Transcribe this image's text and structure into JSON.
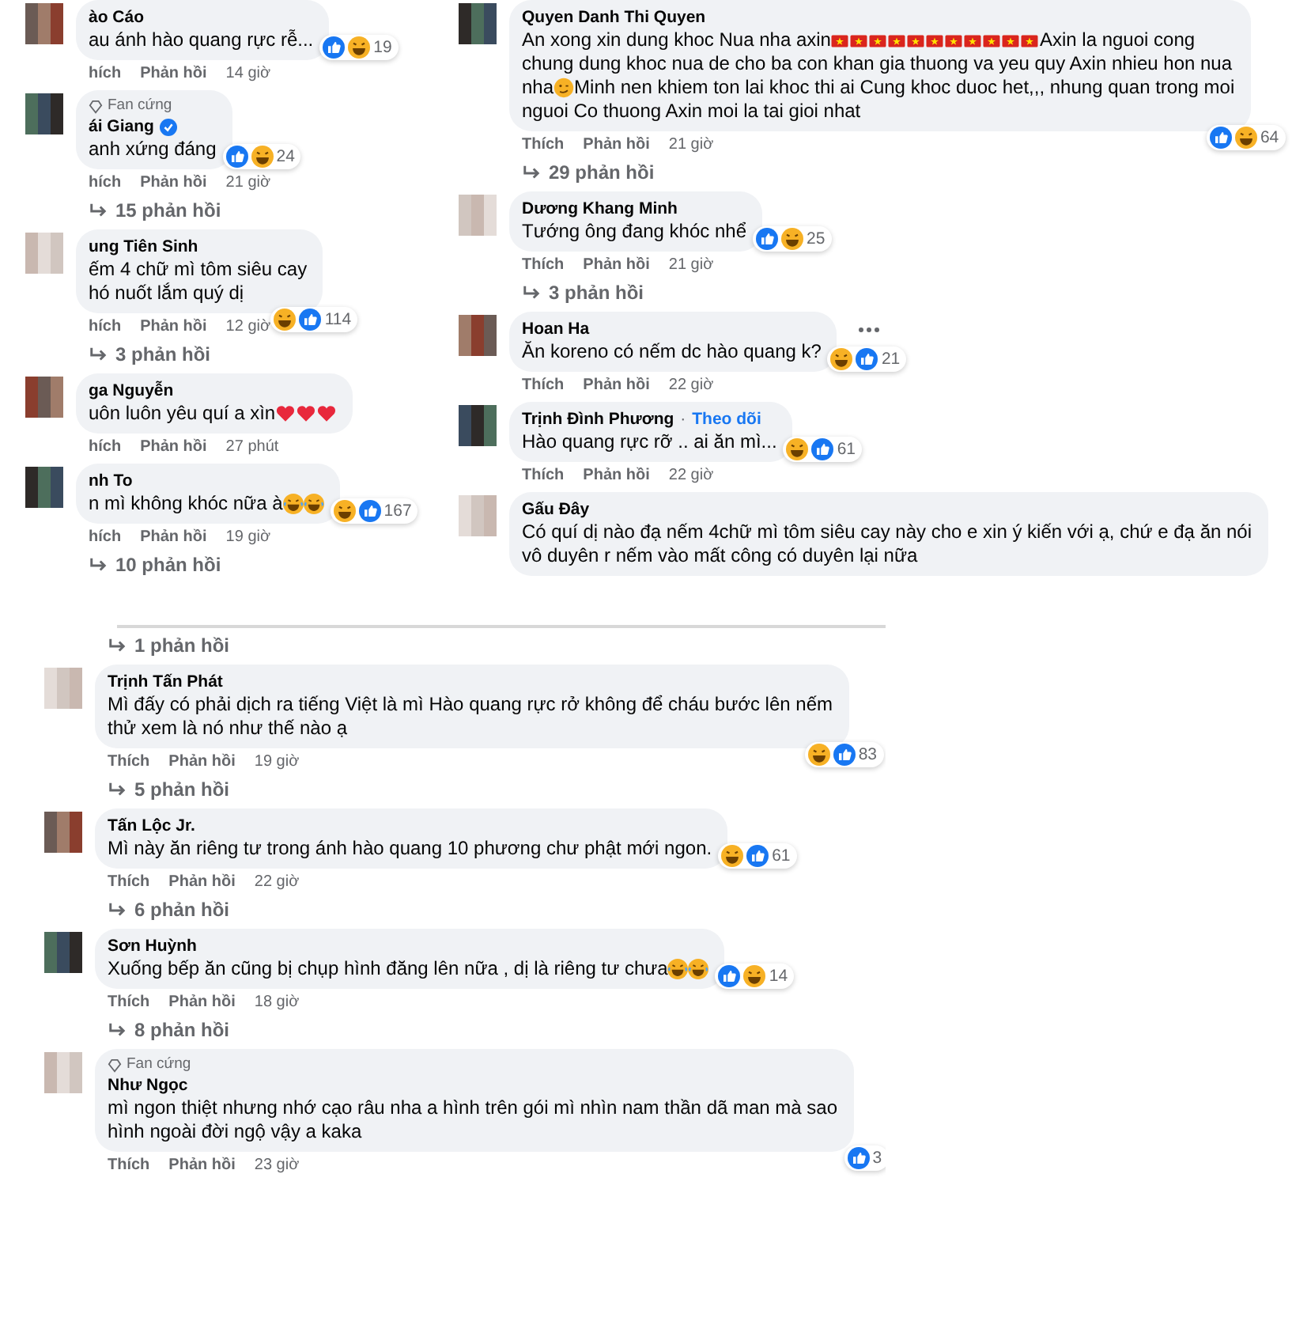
{
  "panels": [
    {
      "comments": [
        {
          "name": "ào Cáo",
          "verified": false,
          "menu": false,
          "lines": [
            [
              {
                "kind": "text",
                "text": "au ánh hào quang rực rễ..."
              }
            ]
          ],
          "reactions": [
            {
              "kind": "like"
            },
            {
              "kind": "haha"
            }
          ],
          "reaction_count": "19",
          "like": "hích",
          "reply": "Phản hồi",
          "time": "14 giờ"
        },
        {
          "badge": "Fan cứng",
          "name": "ái Giang",
          "verified": true,
          "menu": false,
          "lines": [
            [
              {
                "kind": "text",
                "text": "anh xứng đáng"
              }
            ]
          ],
          "reactions": [
            {
              "kind": "like"
            },
            {
              "kind": "haha"
            }
          ],
          "reaction_count": "24",
          "like": "hích",
          "reply": "Phản hồi",
          "time": "21 giờ",
          "replies": "15 phản hồi"
        },
        {
          "name": "ung Tiên Sinh",
          "verified": false,
          "menu": false,
          "lines": [
            [
              {
                "kind": "text",
                "text": "ếm 4 chữ mì tôm siêu cay"
              }
            ],
            [
              {
                "kind": "text",
                "text": "hó nuốt lắm quý dị"
              }
            ]
          ],
          "reactions": [
            {
              "kind": "haha"
            },
            {
              "kind": "like"
            }
          ],
          "reaction_count": "114",
          "like": "hích",
          "reply": "Phản hồi",
          "time": "12 giờ",
          "replies": "3 phản hồi"
        },
        {
          "name": "ga Nguyễn",
          "verified": false,
          "menu": false,
          "lines": [
            [
              {
                "kind": "text",
                "text": "uôn luôn yêu quí a xìn"
              },
              {
                "kind": "heart"
              },
              {
                "kind": "heart"
              },
              {
                "kind": "heart"
              }
            ]
          ],
          "like": "hích",
          "reply": "Phản hồi",
          "time": "27 phút"
        },
        {
          "name": "nh To",
          "verified": false,
          "menu": false,
          "lines": [
            [
              {
                "kind": "text",
                "text": "n mì không khóc nữa à"
              },
              {
                "kind": "laugh-cry"
              },
              {
                "kind": "laugh-cry"
              }
            ]
          ],
          "reactions": [
            {
              "kind": "haha"
            },
            {
              "kind": "like"
            }
          ],
          "reaction_count": "167",
          "like": "hích",
          "reply": "Phản hồi",
          "time": "19 giờ",
          "replies": "10 phản hồi"
        }
      ]
    },
    {
      "comments": [
        {
          "name": "Quyen Danh Thi Quyen",
          "verified": false,
          "menu": false,
          "lines": [
            [
              {
                "kind": "text",
                "text": "An xong xin dung khoc Nua nha axin"
              },
              {
                "kind": "flag"
              },
              {
                "kind": "flag"
              },
              {
                "kind": "flag"
              },
              {
                "kind": "flag"
              },
              {
                "kind": "flag"
              },
              {
                "kind": "flag"
              },
              {
                "kind": "flag"
              },
              {
                "kind": "flag"
              },
              {
                "kind": "flag"
              },
              {
                "kind": "flag"
              },
              {
                "kind": "flag"
              },
              {
                "kind": "text",
                "text": " Axin la nguoi cong"
              }
            ],
            [
              {
                "kind": "text",
                "text": "chung dung khoc nua de cho ba con khan gia thuong va yeu quy Axin nhieu hon nua"
              }
            ],
            [
              {
                "kind": "text",
                "text": "nha"
              },
              {
                "kind": "smirk"
              },
              {
                "kind": "text",
                "text": " Minh nen khiem ton lai khoc thi ai Cung khoc duoc het,,, nhung quan trong moi"
              }
            ],
            [
              {
                "kind": "text",
                "text": "nguoi Co thuong Axin moi la tai gioi nhat"
              }
            ]
          ],
          "reactions": [
            {
              "kind": "like"
            },
            {
              "kind": "haha"
            }
          ],
          "reaction_count": "64",
          "like": "Thích",
          "reply": "Phản hồi",
          "time": "21 giờ",
          "replies": "29 phản hồi"
        },
        {
          "name": "Dương Khang Minh",
          "verified": false,
          "menu": false,
          "lines": [
            [
              {
                "kind": "text",
                "text": "Tướng ông đang khóc nhể"
              }
            ]
          ],
          "reactions": [
            {
              "kind": "like"
            },
            {
              "kind": "haha"
            }
          ],
          "reaction_count": "25",
          "like": "Thích",
          "reply": "Phản hồi",
          "time": "21 giờ",
          "replies": "3 phản hồi"
        },
        {
          "name": "Hoan Ha",
          "verified": false,
          "menu": true,
          "lines": [
            [
              {
                "kind": "text",
                "text": "Ăn koreno có nếm dc hào quang k?"
              }
            ]
          ],
          "reactions": [
            {
              "kind": "haha"
            },
            {
              "kind": "like"
            }
          ],
          "reaction_count": "21",
          "like": "Thích",
          "reply": "Phản hồi",
          "time": "22 giờ"
        },
        {
          "name": "Trịnh Đình Phương",
          "separator": "·",
          "follow": "Theo dõi",
          "verified": false,
          "menu": false,
          "lines": [
            [
              {
                "kind": "text",
                "text": "Hào quang rực rỡ .. ai ăn mì..."
              }
            ]
          ],
          "reactions": [
            {
              "kind": "haha"
            },
            {
              "kind": "like"
            }
          ],
          "reaction_count": "61",
          "like": "Thích",
          "reply": "Phản hồi",
          "time": "22 giờ"
        },
        {
          "name": "Gấu Đây",
          "verified": false,
          "menu": false,
          "lines": [
            [
              {
                "kind": "text",
                "text": "Có quí dị nào đạ nếm 4chữ mì tôm siêu cay này cho e xin ý kiến với ạ, chứ e đạ ăn nói"
              }
            ],
            [
              {
                "kind": "text",
                "text": "vô duyên r nếm vào mất công có duyên lại nữa"
              }
            ]
          ]
        }
      ]
    },
    {
      "leading_replies": "1 phản hồi",
      "comments": [
        {
          "name": "Trịnh Tấn Phát",
          "verified": false,
          "menu": false,
          "lines": [
            [
              {
                "kind": "text",
                "text": "Mì đấy có phải dịch ra tiếng Việt là mì Hào quang rực rở không để cháu bước lên nếm"
              }
            ],
            [
              {
                "kind": "text",
                "text": "thử xem là nó như thế nào ạ"
              }
            ]
          ],
          "reactions": [
            {
              "kind": "haha"
            },
            {
              "kind": "like"
            }
          ],
          "reaction_count": "83",
          "like": "Thích",
          "reply": "Phản hồi",
          "time": "19 giờ",
          "replies": "5 phản hồi"
        },
        {
          "name": "Tấn Lộc Jr.",
          "verified": false,
          "menu": false,
          "lines": [
            [
              {
                "kind": "text",
                "text": "Mì này ăn riêng tư trong ánh hào quang 10 phương chư phật mới ngon."
              }
            ]
          ],
          "reactions": [
            {
              "kind": "haha"
            },
            {
              "kind": "like"
            }
          ],
          "reaction_count": "61",
          "like": "Thích",
          "reply": "Phản hồi",
          "time": "22 giờ",
          "replies": "6 phản hồi"
        },
        {
          "name": "Sơn Huỳnh",
          "verified": false,
          "menu": false,
          "lines": [
            [
              {
                "kind": "text",
                "text": "Xuống bếp ăn cũng bị chụp hình đăng lên nữa , dị là riêng tư chưa"
              },
              {
                "kind": "laugh-cry"
              },
              {
                "kind": "laugh-cry"
              }
            ]
          ],
          "reactions": [
            {
              "kind": "like"
            },
            {
              "kind": "haha"
            }
          ],
          "reaction_count": "14",
          "like": "Thích",
          "reply": "Phản hồi",
          "time": "18 giờ",
          "replies": "8 phản hồi"
        },
        {
          "badge": "Fan cứng",
          "name": "Như Ngọc",
          "verified": false,
          "menu": false,
          "lines": [
            [
              {
                "kind": "text",
                "text": "mì ngon thiệt nhưng nhớ cạo râu nha a hình trên gói mì nhìn nam thần dã man mà sao"
              }
            ],
            [
              {
                "kind": "text",
                "text": "hình ngoài đời ngộ vậy a kaka"
              }
            ]
          ],
          "reactions": [
            {
              "kind": "like"
            }
          ],
          "reaction_count": "3",
          "like": "Thích",
          "reply": "Phản hồi",
          "time": "23 giờ"
        }
      ]
    }
  ]
}
